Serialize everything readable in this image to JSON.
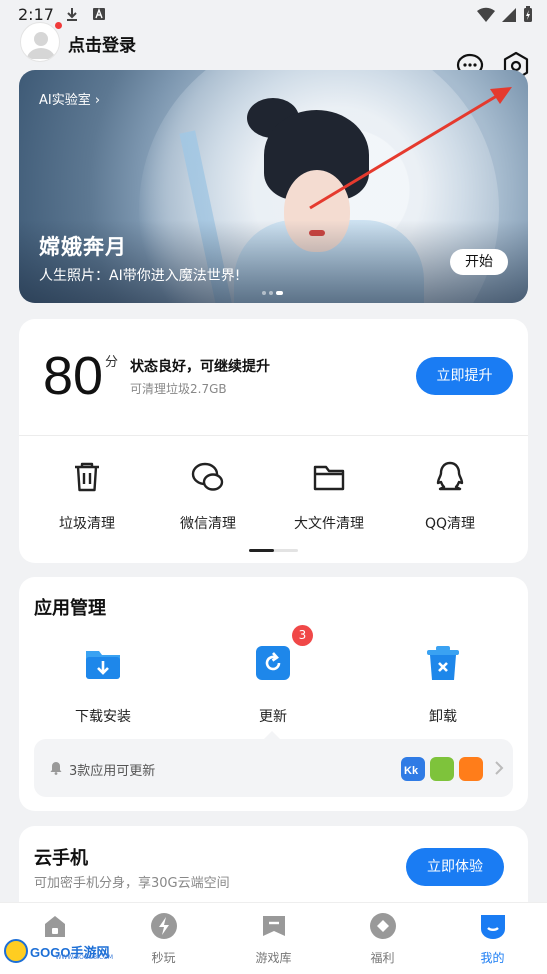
{
  "status_bar": {
    "time": "2:17"
  },
  "header": {
    "login_label": "点击登录"
  },
  "banner": {
    "lab_label": "AI实验室",
    "title": "嫦娥奔月",
    "subtitle": "人生照片：AI带你进入魔法世界!",
    "start_label": "开始"
  },
  "score": {
    "value": "80",
    "unit": "分",
    "title": "状态良好，可继续提升",
    "subtitle": "可清理垃圾2.7GB",
    "boost_label": "立即提升"
  },
  "clean_tools": [
    {
      "label": "垃圾清理",
      "icon": "trash-icon"
    },
    {
      "label": "微信清理",
      "icon": "wechat-icon"
    },
    {
      "label": "大文件清理",
      "icon": "folder-icon"
    },
    {
      "label": "QQ清理",
      "icon": "qq-icon"
    }
  ],
  "app_manage": {
    "title": "应用管理",
    "items": [
      {
        "label": "下载安装",
        "icon": "download-folder-icon"
      },
      {
        "label": "更新",
        "icon": "update-icon",
        "badge": "3"
      },
      {
        "label": "卸载",
        "icon": "uninstall-icon"
      }
    ],
    "update_notice": "3款应用可更新"
  },
  "cloud_phone": {
    "title": "云手机",
    "subtitle": "可加密手机分身，享30G云端空间",
    "button_label": "立即体验"
  },
  "bottom_nav": [
    {
      "label": "",
      "icon": "home-icon"
    },
    {
      "label": "秒玩",
      "icon": "lightning-icon"
    },
    {
      "label": "游戏库",
      "icon": "game-library-icon"
    },
    {
      "label": "福利",
      "icon": "gift-icon"
    },
    {
      "label": "我的",
      "icon": "profile-icon",
      "active": true
    }
  ],
  "watermark": {
    "text": "GOGO手游网",
    "url": "WWW.GOGO8.COM"
  },
  "colors": {
    "accent": "#1a7cf3",
    "badge": "#f04848",
    "background": "#f1f2f4"
  }
}
